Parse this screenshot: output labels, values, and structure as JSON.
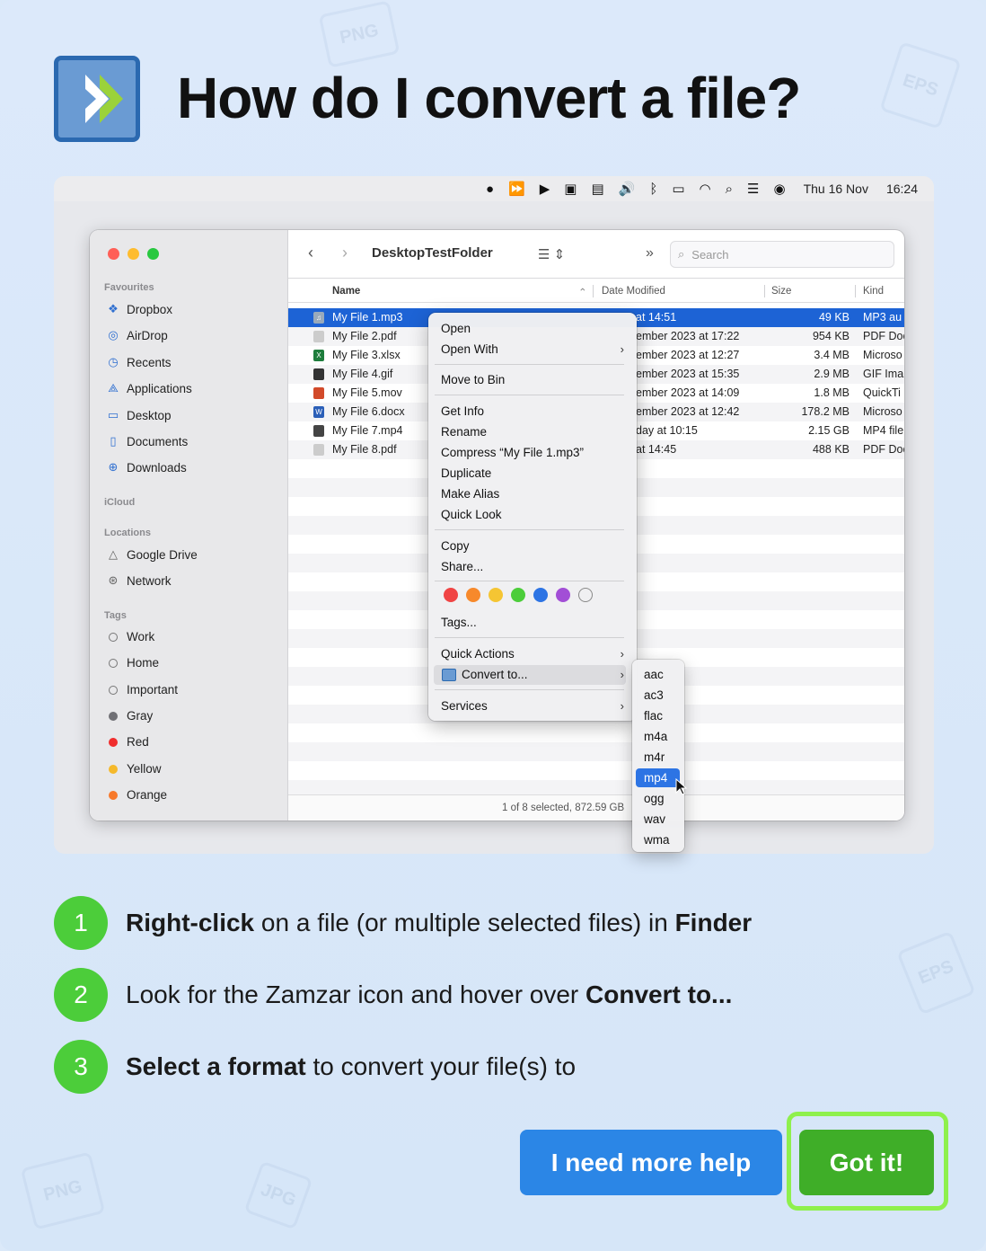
{
  "header": {
    "title": "How do I convert a file?"
  },
  "menubar": {
    "date": "Thu 16 Nov",
    "time": "16:24"
  },
  "finder": {
    "folder": "DesktopTestFolder",
    "search_placeholder": "Search",
    "sidebar": {
      "favourites_label": "Favourites",
      "favourites": [
        "Dropbox",
        "AirDrop",
        "Recents",
        "Applications",
        "Desktop",
        "Documents",
        "Downloads"
      ],
      "icloud_label": "iCloud",
      "locations_label": "Locations",
      "locations": [
        "Google Drive",
        "Network"
      ],
      "tags_label": "Tags",
      "tags": [
        {
          "name": "Work",
          "color": ""
        },
        {
          "name": "Home",
          "color": ""
        },
        {
          "name": "Important",
          "color": ""
        },
        {
          "name": "Gray",
          "color": "#8e8e93"
        },
        {
          "name": "Red",
          "color": "#f43f3f"
        },
        {
          "name": "Yellow",
          "color": "#f5c533"
        },
        {
          "name": "Orange",
          "color": "#f7892b"
        }
      ]
    },
    "columns": {
      "name": "Name",
      "date": "Date Modified",
      "size": "Size",
      "kind": "Kind"
    },
    "files": [
      {
        "name": "My File 1.mp3",
        "date": "at 14:51",
        "size": "49 KB",
        "kind": "MP3 au"
      },
      {
        "name": "My File 2.pdf",
        "date": "ember 2023 at 17:22",
        "size": "954 KB",
        "kind": "PDF Doc"
      },
      {
        "name": "My File 3.xlsx",
        "date": "ember 2023 at 12:27",
        "size": "3.4 MB",
        "kind": "Microso"
      },
      {
        "name": "My File 4.gif",
        "date": "ember 2023 at 15:35",
        "size": "2.9 MB",
        "kind": "GIF Ima"
      },
      {
        "name": "My File 5.mov",
        "date": "ember 2023 at 14:09",
        "size": "1.8 MB",
        "kind": "QuickTi"
      },
      {
        "name": "My File 6.docx",
        "date": "ember 2023 at 12:42",
        "size": "178.2 MB",
        "kind": "Microso"
      },
      {
        "name": "My File 7.mp4",
        "date": "day at 10:15",
        "size": "2.15 GB",
        "kind": "MP4 file"
      },
      {
        "name": "My File 8.pdf",
        "date": "at 14:45",
        "size": "488 KB",
        "kind": "PDF Doc"
      }
    ],
    "status": "1 of 8 selected, 872.59 GB"
  },
  "context_menu": {
    "open": "Open",
    "open_with": "Open With",
    "move_to_bin": "Move to Bin",
    "get_info": "Get Info",
    "rename": "Rename",
    "compress": "Compress “My File 1.mp3”",
    "duplicate": "Duplicate",
    "make_alias": "Make Alias",
    "quick_look": "Quick Look",
    "copy": "Copy",
    "share": "Share...",
    "tags": "Tags...",
    "quick_actions": "Quick Actions",
    "convert_to": "Convert to...",
    "services": "Services",
    "tag_colors": [
      "#f04444",
      "#f7892b",
      "#f5c533",
      "#4ccd3a",
      "#2d74e4",
      "#a24ed6"
    ]
  },
  "formats": [
    "aac",
    "ac3",
    "flac",
    "m4a",
    "m4r",
    "mp4",
    "ogg",
    "wav",
    "wma"
  ],
  "steps": [
    {
      "num": "1",
      "bold1": "Right-click",
      "text1": " on a file (or multiple selected files) in ",
      "bold2": "Finder"
    },
    {
      "num": "2",
      "text1": "Look for the Zamzar icon and hover over ",
      "bold1": "Convert to..."
    },
    {
      "num": "3",
      "bold1": "Select a format",
      "text1": " to convert your file(s) to"
    }
  ],
  "buttons": {
    "help": "I need more help",
    "got_it": "Got it!"
  },
  "colors": {
    "accent_blue": "#2b86e6",
    "accent_green": "#3fae28",
    "step_green": "#4ccd3a",
    "highlight": "#8ef04d"
  }
}
